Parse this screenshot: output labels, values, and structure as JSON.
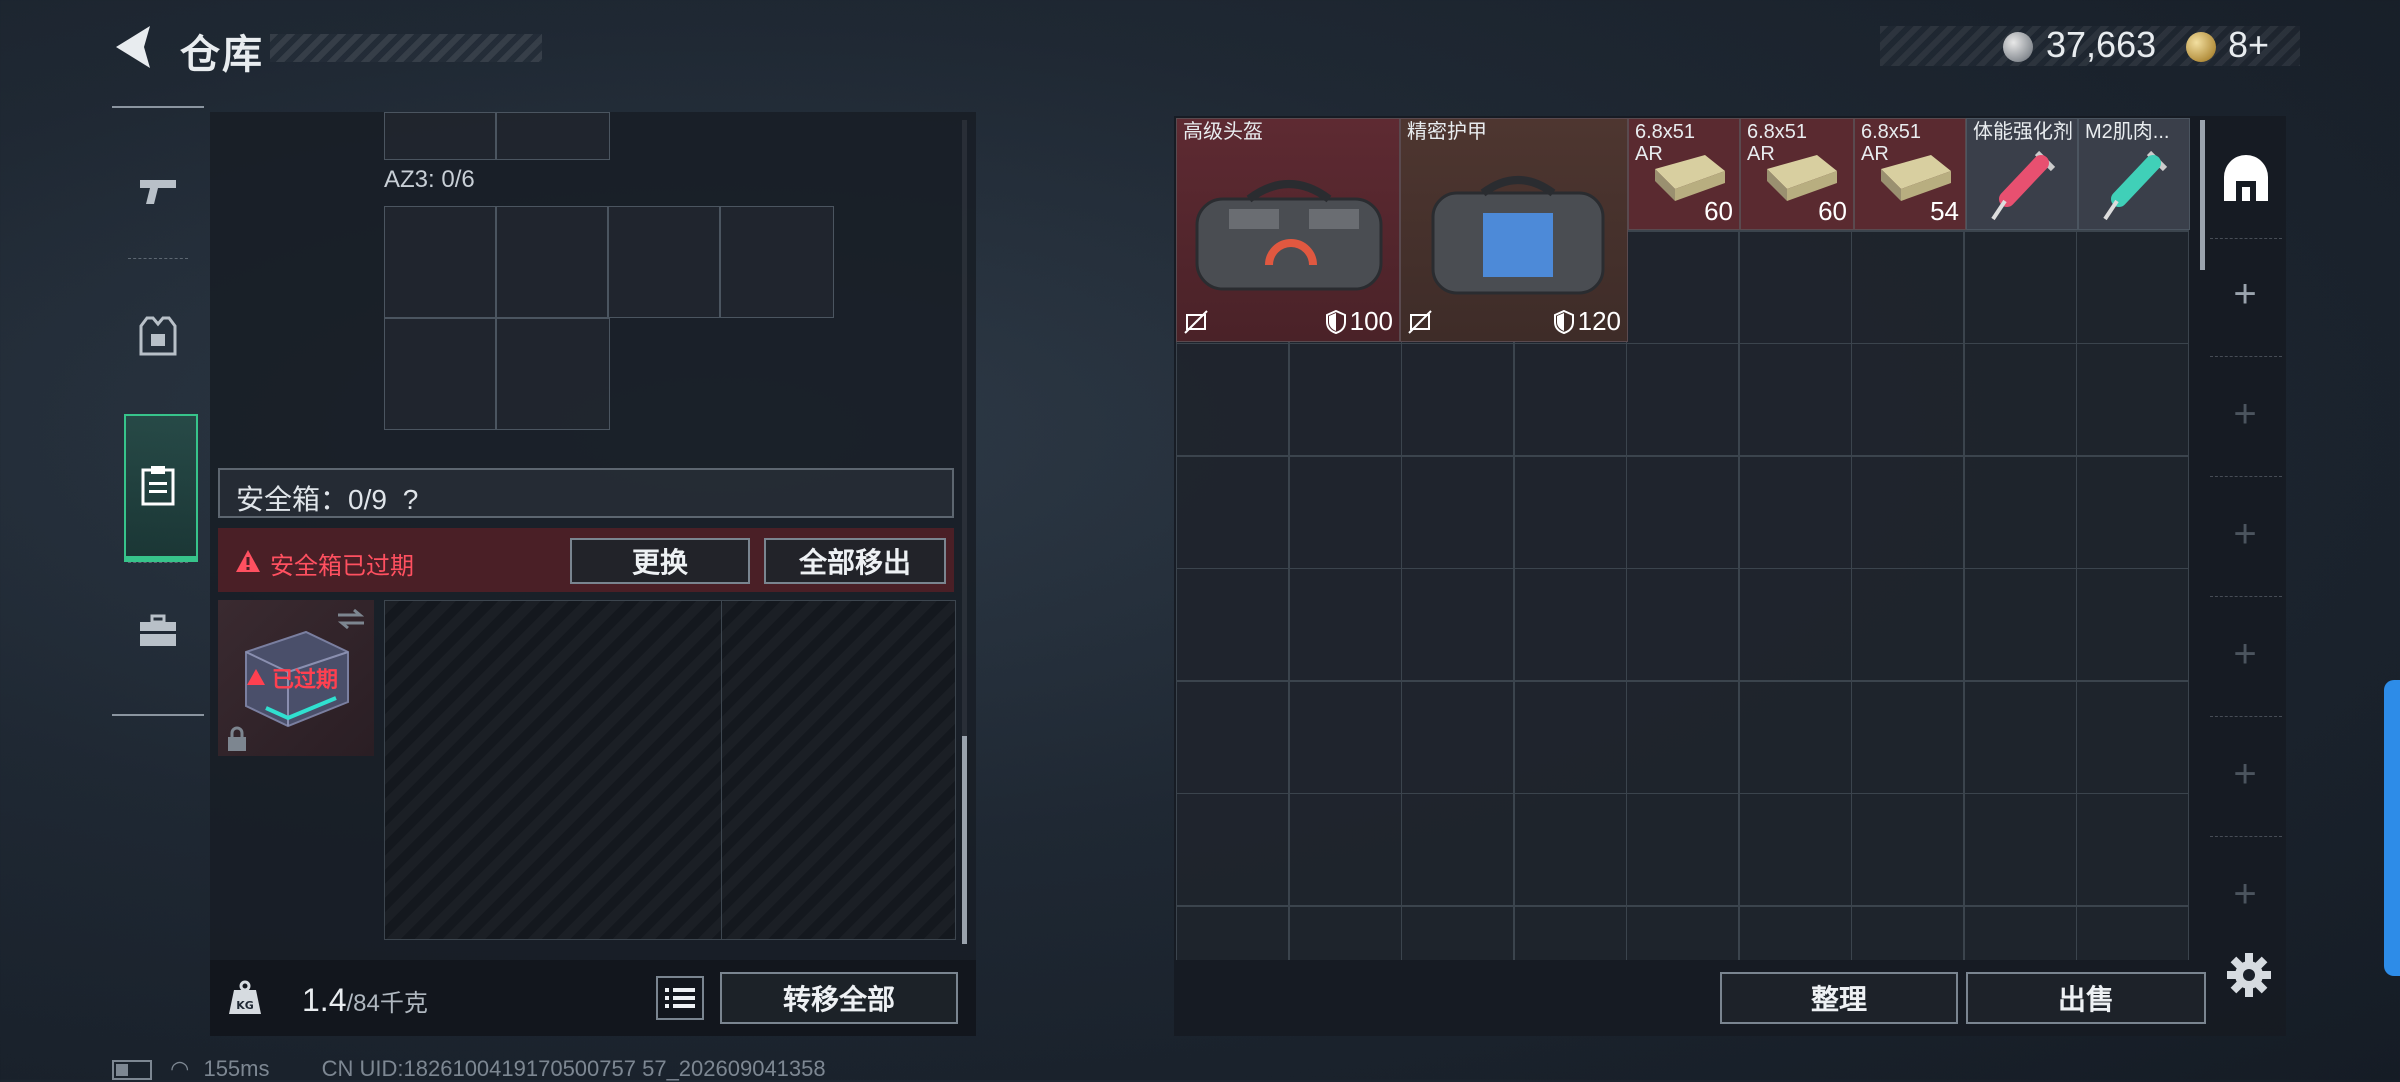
{
  "header": {
    "title": "仓库",
    "currency": [
      {
        "icon": "silver-coin-icon",
        "value": "37,663"
      },
      {
        "icon": "gold-coin-icon",
        "value": "8+"
      }
    ]
  },
  "sidenav": {
    "items": [
      {
        "name": "weapon",
        "icon": "pistol-icon",
        "active": false
      },
      {
        "name": "armor",
        "icon": "vest-icon",
        "active": false
      },
      {
        "name": "safe-box",
        "icon": "clipboard-icon",
        "active": true
      },
      {
        "name": "toolbox",
        "icon": "toolbox-icon",
        "active": false
      }
    ]
  },
  "container": {
    "az3_label": "AZ3: 0/6"
  },
  "safebox": {
    "label": "安全箱：0/9",
    "help": "?",
    "expired_warning": "安全箱已过期",
    "replace_button": "更换",
    "remove_all_button": "全部移出",
    "case_status": "已过期"
  },
  "bottom_left": {
    "weight_current": "1.4",
    "weight_max": "/84千克",
    "transfer_all_button": "转移全部"
  },
  "stash": {
    "items": [
      {
        "name": "高级头盔",
        "durability": "100",
        "type": "helmet"
      },
      {
        "name": "精密护甲",
        "durability": "120",
        "type": "armor"
      },
      {
        "name": "6.8x51",
        "sub": "AR",
        "count": "60",
        "type": "ammo"
      },
      {
        "name": "6.8x51",
        "sub": "AR",
        "count": "60",
        "type": "ammo"
      },
      {
        "name": "6.8x51",
        "sub": "AR",
        "count": "54",
        "type": "ammo"
      },
      {
        "name": "体能强化剂",
        "type": "injector-red"
      },
      {
        "name": "M2肌肉...",
        "type": "injector-teal"
      }
    ],
    "sort_button": "整理",
    "sell_button": "出售"
  },
  "status_bar": {
    "ping": "155ms",
    "uid": "CN UID:1826100419170500757 57_202609041358"
  },
  "colors": {
    "accent_green": "#37c48b",
    "warning_red": "#ff5060",
    "item_red_bg": "#5a2a30",
    "edge_blue": "#2d8ce8"
  }
}
